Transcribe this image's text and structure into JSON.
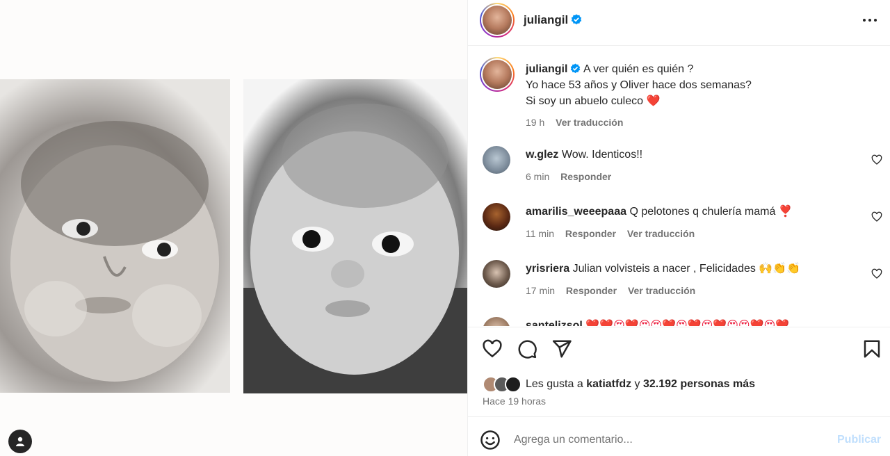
{
  "post": {
    "username": "juliangil",
    "verified": true,
    "caption_lines": [
      "A ver quién es quién ?",
      "Yo hace 53 años y Oliver hace dos semanas?",
      "Si soy un abuelo culeco"
    ],
    "caption_emoji": "❤️",
    "caption_time": "19 h",
    "translate_label": "Ver traducción"
  },
  "comments": [
    {
      "username": "w.glez",
      "text": "Wow. Identicos!!",
      "time": "6 min",
      "reply_label": "Responder",
      "translate_label": ""
    },
    {
      "username": "amarilis_weeepaaa",
      "text": "Q pelotones q chulería mamá",
      "emoji": "❣️",
      "time": "11 min",
      "reply_label": "Responder",
      "translate_label": "Ver traducción"
    },
    {
      "username": "yrisriera",
      "text": "Julian volvisteis a nacer , Felicidades",
      "emoji": "🙌👏👏",
      "time": "17 min",
      "reply_label": "Responder",
      "translate_label": "Ver traducción"
    },
    {
      "username": "santelizsol",
      "text": "",
      "emoji": "❤️❤️😍❤️😍😍❤️😍❤️😍❤️😍😍❤️😍❤️",
      "time": "",
      "reply_label": "",
      "translate_label": ""
    }
  ],
  "likes": {
    "prefix": "Les gusta a",
    "user": "katiatfdz",
    "connector": "y",
    "count_text": "32.192 personas más",
    "time_ago": "Hace 19 horas"
  },
  "composer": {
    "placeholder": "Agrega un comentario...",
    "publish_label": "Publicar"
  },
  "icons": {
    "header_more": "more-horizontal-icon",
    "like": "heart-outline-icon",
    "comment": "comment-bubble-icon",
    "share": "paper-plane-icon",
    "save": "bookmark-icon",
    "emoji": "smiley-icon",
    "user_tag": "user-silhouette-icon"
  },
  "colors": {
    "verified": "#0095f6",
    "heart_red": "#ed1c3c",
    "publish_disabled": "#c0dffd",
    "secondary_text": "#737373"
  }
}
